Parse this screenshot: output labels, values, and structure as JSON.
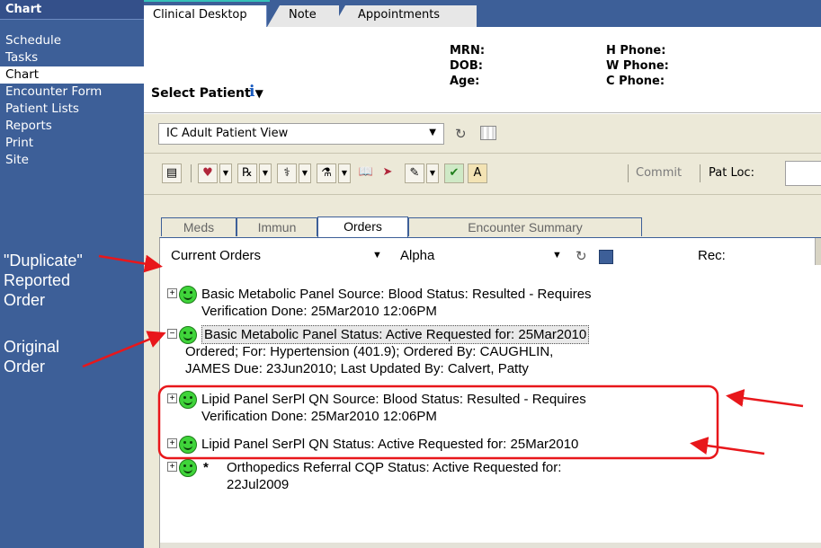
{
  "sidebar": {
    "title": "Chart",
    "items": [
      {
        "label": "Schedule"
      },
      {
        "label": "Tasks"
      },
      {
        "label": "Chart",
        "active": true
      },
      {
        "label": "Encounter Form"
      },
      {
        "label": "Patient Lists"
      },
      {
        "label": "Reports"
      },
      {
        "label": "Print"
      },
      {
        "label": "Site"
      }
    ]
  },
  "annotations": {
    "duplicate": "\"Duplicate\" Reported Order",
    "duplicate_lines": [
      "\"Duplicate\"",
      "Reported",
      "Order"
    ],
    "original_lines": [
      "Original",
      "Order"
    ],
    "arrow_color": "#e8171b"
  },
  "top_tabs": [
    {
      "label": "Clinical Desktop",
      "active": true
    },
    {
      "label": "Note"
    },
    {
      "label": "Appointments"
    }
  ],
  "patient_header": {
    "select_patient": "Select Patient",
    "info_icon": "info-icon",
    "labels": {
      "mrn": "MRN:",
      "dob": "DOB:",
      "age": "Age:",
      "h_phone": "H Phone:",
      "w_phone": "W Phone:",
      "c_phone": "C Phone:"
    }
  },
  "view_bar": {
    "selected_view": "IC Adult Patient View"
  },
  "toolbar": {
    "commit": "Commit",
    "pat_loc": "Pat Loc:"
  },
  "content_tabs": [
    {
      "label": "Meds"
    },
    {
      "label": "Immun"
    },
    {
      "label": "Orders",
      "active": true
    },
    {
      "label": "Encounter Summary"
    }
  ],
  "orders_filter": {
    "current": "Current Orders",
    "sort": "Alpha",
    "rec": "Rec:"
  },
  "orders": [
    {
      "expander": "+",
      "lines": [
        "Basic Metabolic Panel  Source: Blood  Status: Resulted - Requires",
        "Verification  Done: 25Mar2010 12:06PM"
      ]
    },
    {
      "expander": "−",
      "selected": true,
      "lines": [
        "Basic Metabolic Panel  Status: Active  Requested for: 25Mar2010",
        "Ordered; For: Hypertension (401.9); Ordered By: CAUGHLIN,",
        "JAMES  Due: 23Jun2010; Last Updated By: Calvert, Patty"
      ]
    },
    {
      "expander": "+",
      "lines": [
        "Lipid Panel SerPl QN  Source: Blood  Status: Resulted - Requires",
        "Verification  Done: 25Mar2010 12:06PM"
      ]
    },
    {
      "expander": "+",
      "lines": [
        "Lipid Panel SerPl QN  Status: Active  Requested for: 25Mar2010"
      ]
    },
    {
      "expander": "+",
      "star": "*",
      "lines": [
        "Orthopedics Referral CQP     Status: Active  Requested for:",
        "22Jul2009"
      ]
    }
  ],
  "colors": {
    "sidebar": "#3d5f98",
    "status_smiley": "#3fd43a",
    "annotation": "#e8171b"
  }
}
